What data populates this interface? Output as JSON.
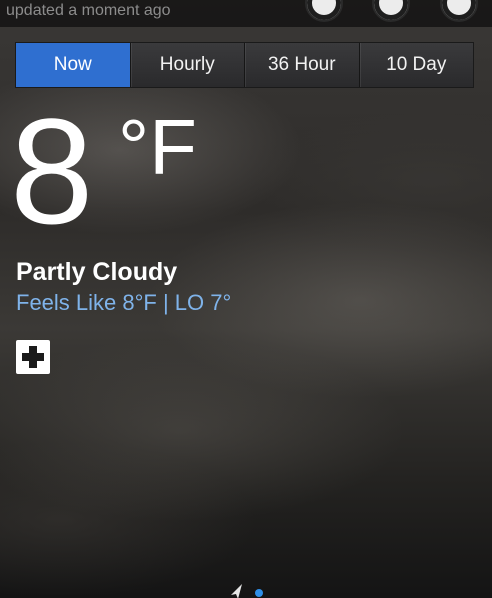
{
  "header": {
    "updated_text": "updated a moment ago",
    "icons": [
      "settings-icon",
      "search-icon",
      "gear-icon"
    ]
  },
  "tabs": [
    {
      "label": "Now",
      "active": true
    },
    {
      "label": "Hourly",
      "active": false
    },
    {
      "label": "36 Hour",
      "active": false
    },
    {
      "label": "10 Day",
      "active": false
    }
  ],
  "current": {
    "temperature": "8",
    "unit": "°F",
    "condition": "Partly Cloudy",
    "feels_like": "Feels Like 8°F |  LO 7°"
  },
  "pager": {
    "icons": [
      "location-arrow-icon",
      "page-dot"
    ],
    "active_color": "#2f8fe8"
  },
  "colors": {
    "accent": "#2f6fd0",
    "feels_like_text": "#7fb3ea"
  }
}
